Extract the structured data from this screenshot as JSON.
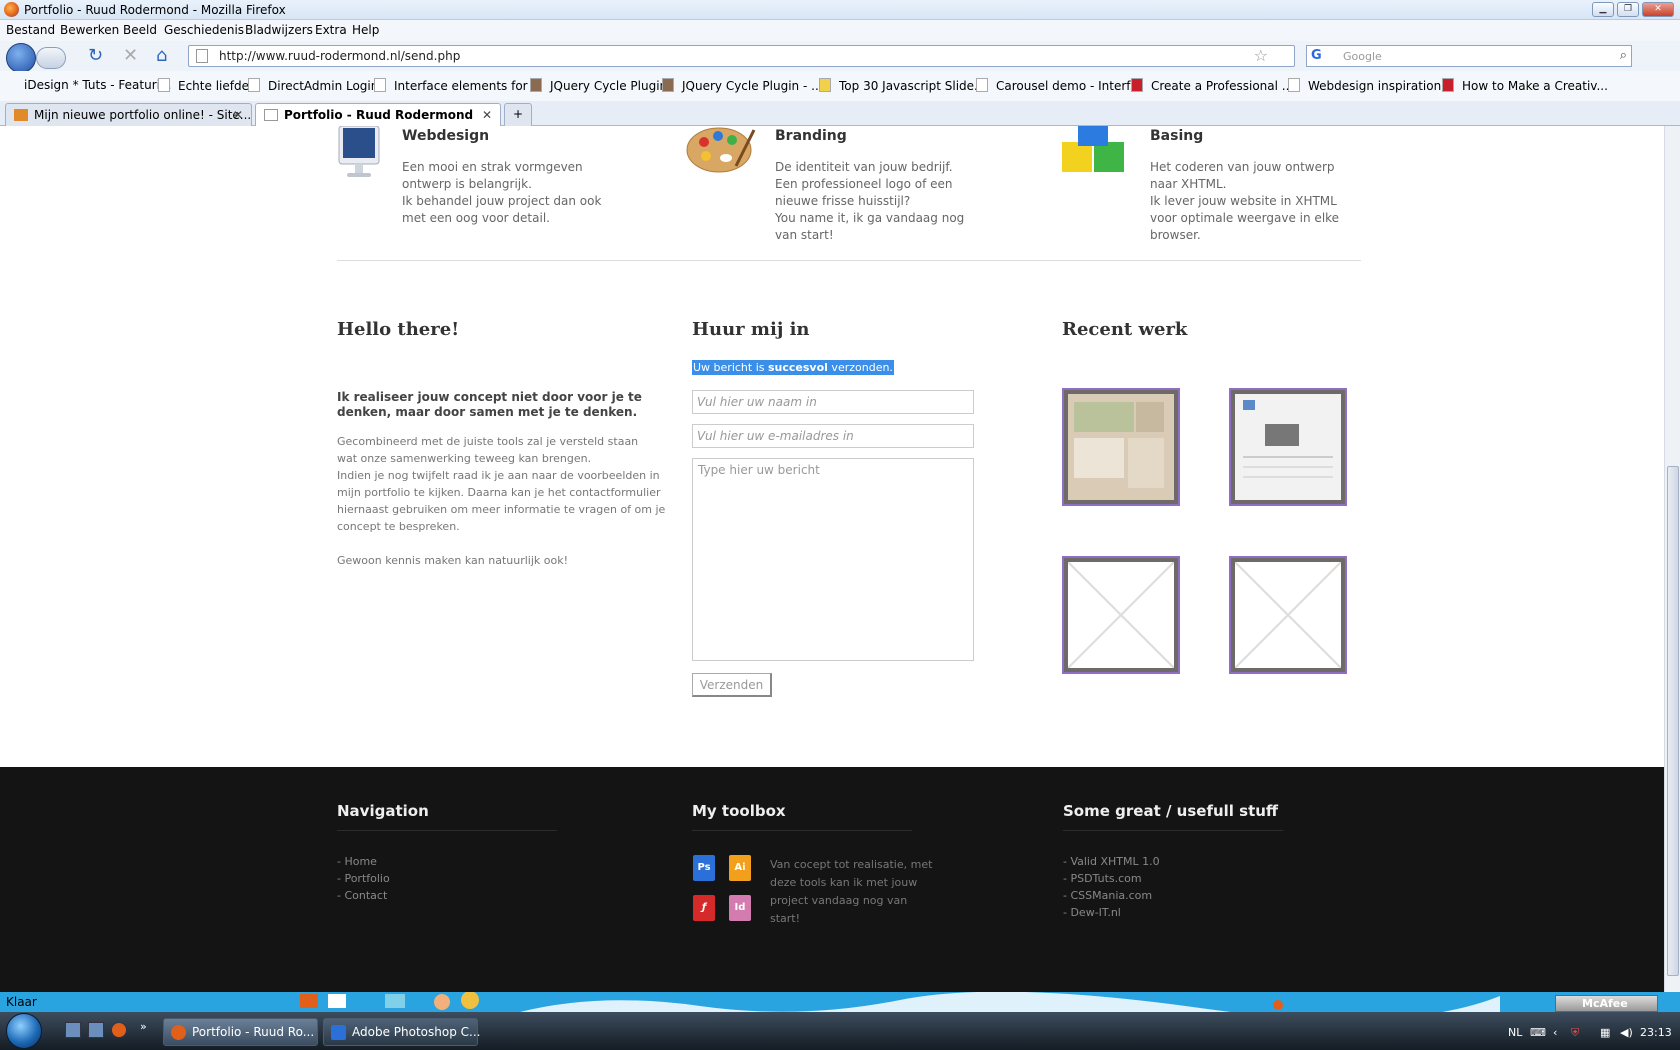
{
  "window": {
    "title": "Portfolio - Ruud Rodermond - Mozilla Firefox"
  },
  "menu": [
    "Bestand",
    "Bewerken",
    "Beeld",
    "Geschiedenis",
    "Bladwijzers",
    "Extra",
    "Help"
  ],
  "nav": {
    "url": "http://www.ruud-rodermond.nl/send.php",
    "search_placeholder": "Google"
  },
  "bookmarks": [
    "iDesign * Tuts - Featuri...",
    "Echte liefde",
    "DirectAdmin Login",
    "Interface elements for ...",
    "JQuery Cycle Plugin",
    "JQuery Cycle Plugin - ...",
    "Top 30 Javascript Slide...",
    "Carousel demo - Interf...",
    "Create a Professional ...",
    "Webdesign inspiration...",
    "How to Make a Creativ..."
  ],
  "tabs": [
    {
      "label": "Mijn nieuwe portfolio online! - Site..."
    },
    {
      "label": "Portfolio - Ruud Rodermond"
    }
  ],
  "services": [
    {
      "title": "Webdesign",
      "lines": [
        "Een mooi en strak vormgeven",
        "ontwerp is belangrijk.",
        "Ik behandel jouw project dan ook",
        "met een oog voor detail."
      ]
    },
    {
      "title": "Branding",
      "lines": [
        "De identiteit van jouw bedrijf.",
        "Een professioneel logo of een",
        "nieuwe frisse huisstijl?",
        "You name it, ik ga vandaag nog",
        "van start!"
      ]
    },
    {
      "title": "Basing",
      "lines": [
        "Het coderen van jouw ontwerp",
        "naar XHTML.",
        "Ik lever jouw website in XHTML",
        "voor optimale weergave in elke",
        "browser."
      ]
    }
  ],
  "hello": {
    "title": "Hello there!",
    "intro": [
      "Ik realiseer jouw concept niet door voor je te",
      "denken, maar door samen met je te denken."
    ],
    "body": [
      "Gecombineerd met de juiste tools zal je versteld staan",
      "wat onze samenwerking teweeg kan brengen.",
      "Indien je nog twijfelt raad ik je aan naar de voorbeelden in",
      "mijn portfolio te kijken. Daarna kan je het contactformulier",
      "hiernaast gebruiken om meer informatie te vragen of om je",
      "concept te bespreken.",
      "",
      "Gewoon kennis maken kan natuurlijk ook!"
    ]
  },
  "hire": {
    "title": "Huur mij in",
    "success_pre": "Uw bericht is ",
    "success_bold": "succesvol",
    "success_post": " verzonden.",
    "name_placeholder": "Vul hier uw naam in",
    "email_placeholder": "Vul hier uw e-mailadres in",
    "message_placeholder": "Type hier uw bericht",
    "send_label": "Verzenden"
  },
  "recent": {
    "title": "Recent werk"
  },
  "footer": {
    "nav_title": "Navigation",
    "nav_links": [
      "- Home",
      "- Portfolio",
      "- Contact"
    ],
    "toolbox_title": "My toolbox",
    "tools": [
      {
        "label": "Ps",
        "color": "#2b6fd8"
      },
      {
        "label": "Ai",
        "color": "#f2a01c"
      },
      {
        "label": "",
        "color": "#d42a2a"
      },
      {
        "label": "Id",
        "color": "#d47bb0"
      }
    ],
    "toolbox_text": [
      "Van cocept tot realisatie, met",
      "deze tools kan ik met jouw",
      "project vandaag nog van",
      "start!"
    ],
    "stuff_title": "Some great / usefull stuff",
    "stuff_links": [
      "- Valid XHTML 1.0",
      "- PSDTuts.com",
      "- CSSMania.com",
      "- Dew-IT.nl"
    ]
  },
  "status": {
    "text": "Klaar",
    "mcafee": "McAfee"
  },
  "taskbar": {
    "buttons": [
      "Portfolio - Ruud Ro...",
      "Adobe Photoshop C..."
    ],
    "lang": "NL",
    "clock": "23:13"
  }
}
